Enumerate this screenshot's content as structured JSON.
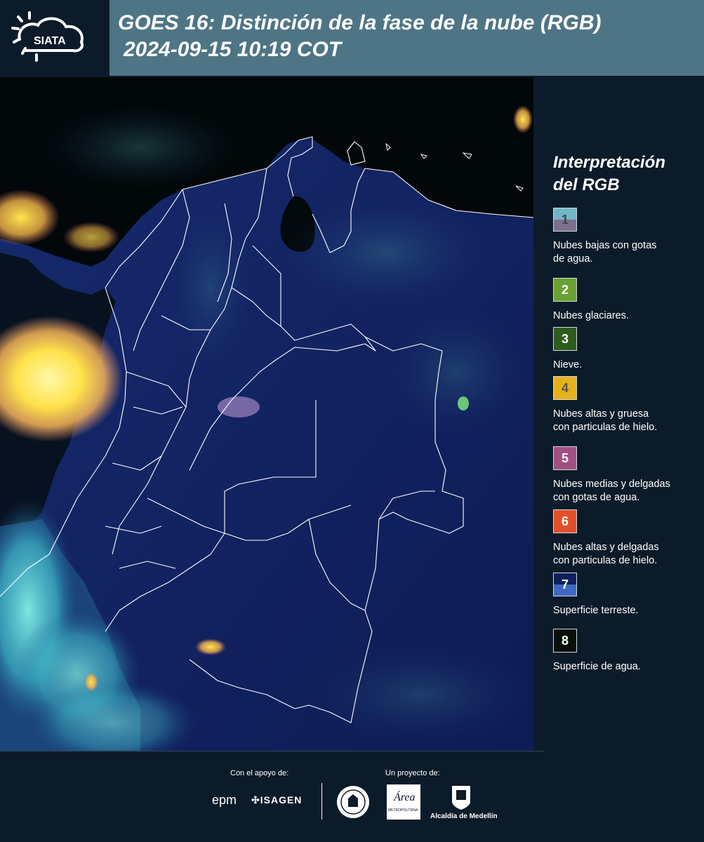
{
  "header": {
    "logo_text": "SIATA",
    "title_line1": "GOES 16: Distinción de la fase de la nube (RGB)",
    "title_line2": "2024-09-15 10:19 COT"
  },
  "legend": {
    "title_line1": "Interpretación",
    "title_line2": "del RGB",
    "items": [
      {
        "number": "1",
        "label_line1": "Nubes bajas con gotas",
        "label_line2": "de agua.",
        "color_top": "#6fb6c7",
        "color_bottom": "#7d6f8f",
        "text_color": "#444"
      },
      {
        "number": "2",
        "label_line1": "Nubes glaciares.",
        "label_line2": "",
        "color_top": "#6aa132",
        "color_bottom": "#6aa132",
        "text_color": "#fff"
      },
      {
        "number": "3",
        "label_line1": "Nieve.",
        "label_line2": "",
        "color_top": "#2e5c1d",
        "color_bottom": "#2e5c1d",
        "text_color": "#fff"
      },
      {
        "number": "4",
        "label_line1": "Nubes altas y gruesa",
        "label_line2": "con particulas de hielo.",
        "color_top": "#e6b21b",
        "color_bottom": "#e6b21b",
        "text_color": "#555"
      },
      {
        "number": "5",
        "label_line1": "Nubes medias y delgadas",
        "label_line2": "con gotas de agua.",
        "color_top": "#a24f83",
        "color_bottom": "#a24f83",
        "text_color": "#fff"
      },
      {
        "number": "6",
        "label_line1": "Nubes altas y delgadas",
        "label_line2": "con particulas de hielo.",
        "color_top": "#e2502b",
        "color_bottom": "#e2502b",
        "text_color": "#fff"
      },
      {
        "number": "7",
        "label_line1": "Superficie terreste.",
        "label_line2": "",
        "color_top": "#0f1f5c",
        "color_bottom": "#3e68c4",
        "text_color": "#fff"
      },
      {
        "number": "8",
        "label_line1": "Superficie de agua.",
        "label_line2": "",
        "color_top": "#0a0f0a",
        "color_bottom": "#0a0f0a",
        "text_color": "#fff"
      }
    ]
  },
  "footer": {
    "support_label": "Con el apoyo de:",
    "project_label": "Un proyecto de:",
    "sponsor_epm": "epm",
    "sponsor_isagen": "ISAGEN",
    "area_text": "Área",
    "area_sub": "METROPOLITANA",
    "alcaldia": "Alcaldía de Medellín"
  }
}
